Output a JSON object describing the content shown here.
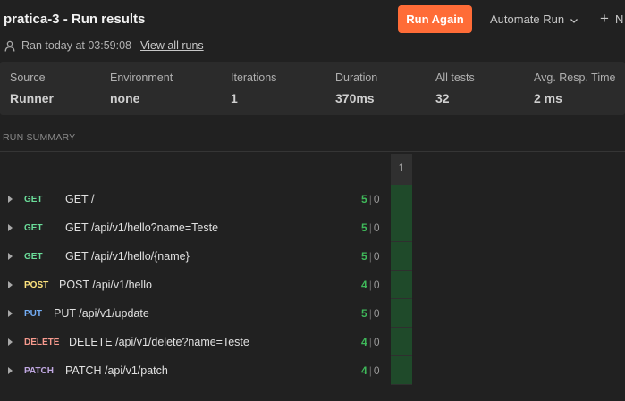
{
  "header": {
    "title": "pratica-3 - Run results",
    "ran_text": "Ran today at 03:59:08",
    "view_all_runs": "View all runs",
    "run_again": "Run Again",
    "automate_run": "Automate Run",
    "new_label": "N"
  },
  "stats": [
    {
      "label": "Source",
      "value": "Runner"
    },
    {
      "label": "Environment",
      "value": "none"
    },
    {
      "label": "Iterations",
      "value": "1"
    },
    {
      "label": "Duration",
      "value": "370ms"
    },
    {
      "label": "All tests",
      "value": "32"
    },
    {
      "label": "Avg. Resp. Time",
      "value": "2 ms"
    }
  ],
  "summary": {
    "heading": "RUN SUMMARY",
    "iteration_header": "1",
    "requests": [
      {
        "method": "GET",
        "name": "GET /",
        "passed": "5",
        "failed": "0"
      },
      {
        "method": "GET",
        "name": "GET /api/v1/hello?name=Teste",
        "passed": "5",
        "failed": "0"
      },
      {
        "method": "GET",
        "name": "GET /api/v1/hello/{name}",
        "passed": "5",
        "failed": "0"
      },
      {
        "method": "POST",
        "name": "POST /api/v1/hello",
        "passed": "4",
        "failed": "0"
      },
      {
        "method": "PUT",
        "name": "PUT /api/v1/update",
        "passed": "5",
        "failed": "0"
      },
      {
        "method": "DELETE",
        "name": "DELETE /api/v1/delete?name=Teste",
        "passed": "4",
        "failed": "0"
      },
      {
        "method": "PATCH",
        "name": "PATCH /api/v1/patch",
        "passed": "4",
        "failed": "0"
      }
    ]
  },
  "colors": {
    "accent": "#ff6c37",
    "GET": "#6bdd9a",
    "POST": "#ffe47e",
    "PUT": "#74aef6",
    "DELETE": "#f79a8e",
    "PATCH": "#c0a8e1",
    "pass": "#3fb95a",
    "iteration_cell": "#1f4a2a"
  }
}
